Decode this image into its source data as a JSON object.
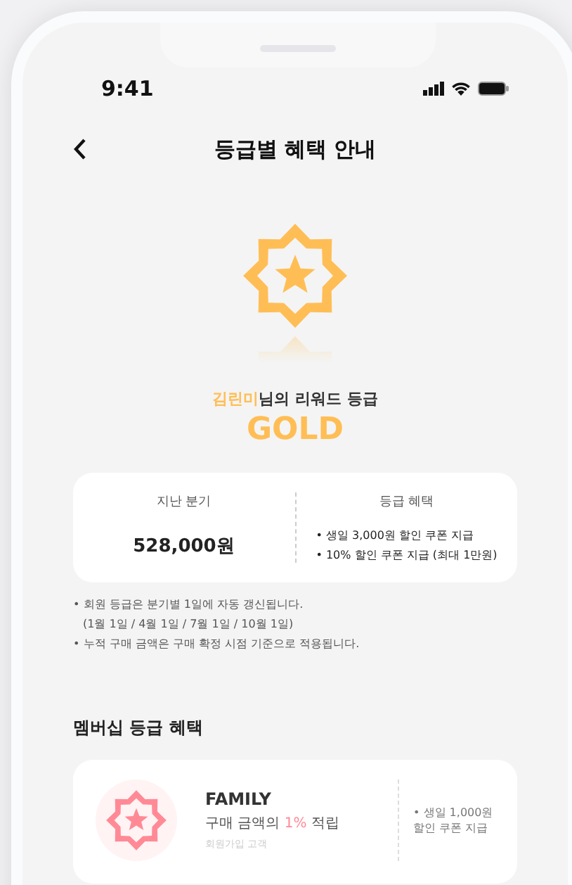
{
  "status_bar": {
    "time": "9:41"
  },
  "header": {
    "title": "등급별 혜택 안내"
  },
  "grade": {
    "user_name": "김린미",
    "suffix": "님의 리워드 등급",
    "grade_name": "GOLD"
  },
  "summary": {
    "left_label": "지난 분기",
    "amount": "528,000원",
    "right_label": "등급 혜택",
    "benefits": [
      "• 생일 3,000원 할인 쿠폰 지급",
      "• 10% 할인 쿠폰 지급 (최대 1만원)"
    ]
  },
  "notes": [
    {
      "kind": "bullet",
      "text": "• 회원 등급은 분기별 1일에 자동 갱신됩니다."
    },
    {
      "kind": "continuation",
      "text": "(1월 1일 / 4월 1일 / 7월 1일 / 10월 1일)"
    },
    {
      "kind": "bullet",
      "text": "• 누적 구매 금액은 구매 확정 시점 기준으로 적용됩니다."
    }
  ],
  "section_title": "멤버십 등급 혜택",
  "tiers": [
    {
      "name": "FAMILY",
      "color": "#ff8a96",
      "rate_prefix": "구매 금액의",
      "rate": "1%",
      "rate_suffix": "적립",
      "condition": "회원가입 고객",
      "benefit": "• 생일 1,000원 할인 쿠폰 지급"
    }
  ]
}
